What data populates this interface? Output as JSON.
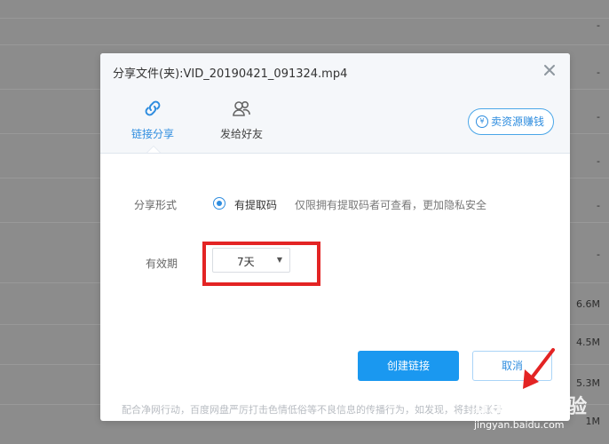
{
  "background": {
    "sizes": [
      "-",
      "-",
      "-",
      "-",
      "-",
      "-",
      "6.6M",
      "4.5M",
      "5.3M",
      "1M"
    ]
  },
  "dialog": {
    "title": "分享文件(夹):VID_20190421_091324.mp4",
    "tabs": [
      {
        "label": "链接分享",
        "icon": "link-icon",
        "active": true
      },
      {
        "label": "发给好友",
        "icon": "friends-icon",
        "active": false
      }
    ],
    "earn_button": "卖资源赚钱",
    "share_form_label": "分享形式",
    "radio_option": "有提取码",
    "radio_hint": "仅限拥有提取码者可查看，更加隐私安全",
    "validity_label": "有效期",
    "validity_value": "7天",
    "create_button": "创建链接",
    "cancel_button": "取消",
    "footer_note": "配合净网行动，百度网盘严厉打击色情低俗等不良信息的传播行为，如发现，将封禁账号"
  },
  "colors": {
    "accent": "#1a98f0",
    "highlight_box": "#e32424"
  },
  "watermark": {
    "logo": "Bai百度经验",
    "url": "jingyan.baidu.com"
  }
}
